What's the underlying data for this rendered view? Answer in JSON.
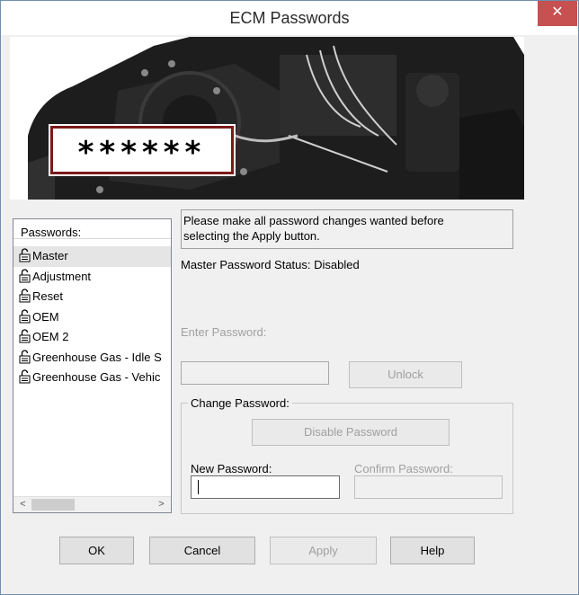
{
  "window": {
    "title": "ECM Passwords",
    "close_glyph": "✕"
  },
  "banner": {
    "masked_password": "******"
  },
  "passwords_list": {
    "header": "Passwords:",
    "items": [
      {
        "label": "Master",
        "icon": "lock-icon"
      },
      {
        "label": "Adjustment",
        "icon": "lock-icon"
      },
      {
        "label": "Reset",
        "icon": "lock-icon"
      },
      {
        "label": "OEM",
        "icon": "lock-icon"
      },
      {
        "label": "OEM 2",
        "icon": "lock-icon"
      },
      {
        "label": "Greenhouse Gas - Idle S",
        "icon": "lock-icon"
      },
      {
        "label": "Greenhouse Gas - Vehic",
        "icon": "lock-icon"
      }
    ],
    "scroll_left": "<",
    "scroll_right": ">"
  },
  "message": {
    "line1": "Please make all password changes wanted before",
    "line2": "selecting the Apply button."
  },
  "status": {
    "label": "Master Password Status:",
    "value": "Disabled"
  },
  "enter_password": {
    "label": "Enter Password:",
    "value": "",
    "unlock_label": "Unlock"
  },
  "change_password": {
    "group_label": "Change Password:",
    "disable_label": "Disable Password",
    "new_label": "New Password:",
    "new_value": "",
    "confirm_label": "Confirm Password:",
    "confirm_value": ""
  },
  "buttons": {
    "ok": "OK",
    "cancel": "Cancel",
    "apply": "Apply",
    "help": "Help"
  },
  "colors": {
    "close_button": "#c75050",
    "banner_frame": "#7b1a1a",
    "selection": "#e5e5e5"
  }
}
